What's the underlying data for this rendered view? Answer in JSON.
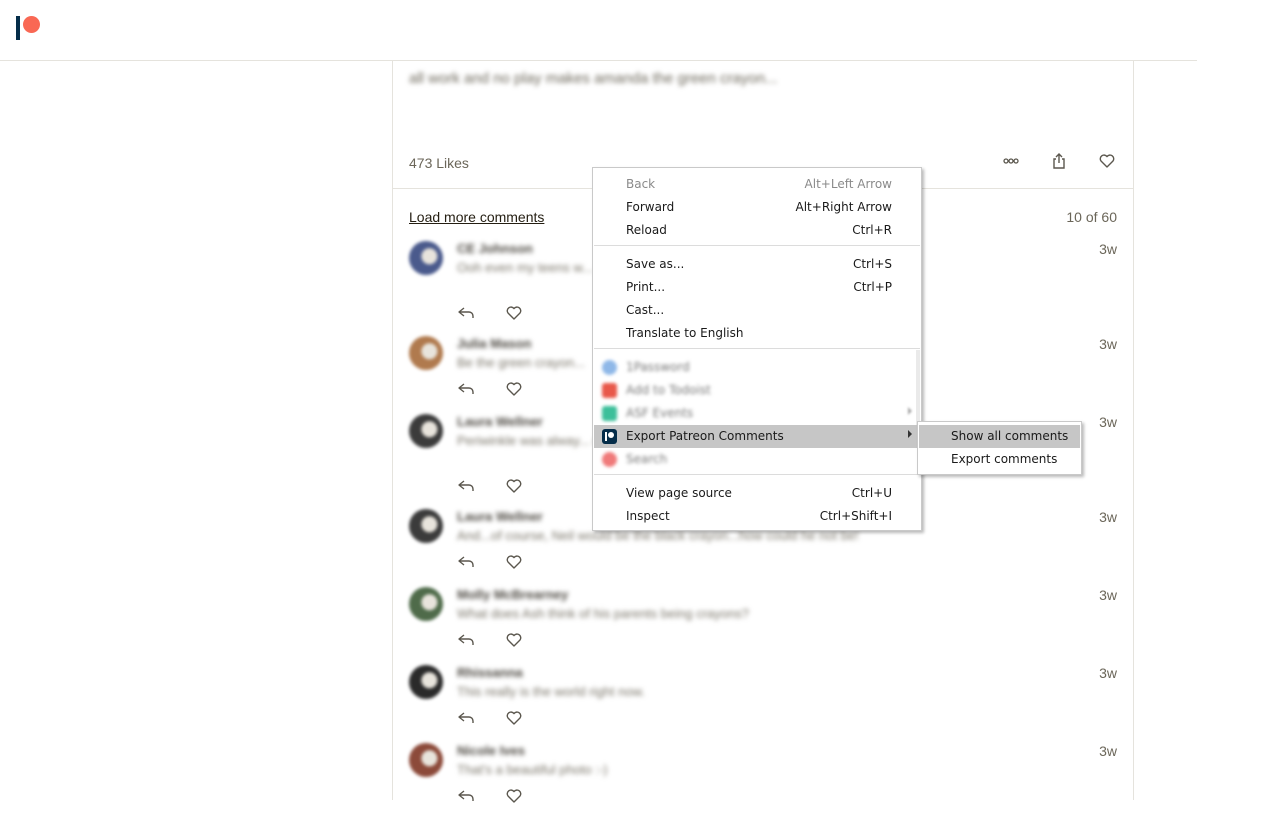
{
  "header": {
    "logo": "patreon-logo"
  },
  "post": {
    "text": "all work and no play makes amanda the green crayon...",
    "likes": "473 Likes",
    "actions": [
      "more-icon",
      "share-icon",
      "heart-icon"
    ]
  },
  "comments_bar": {
    "load_more": "Load more comments",
    "count": "10 of 60"
  },
  "comments": [
    {
      "author": "CE Johnson",
      "body": "Ooh even my teens w... you can find calm. I hope you can find groundin...",
      "time": "3w",
      "avatar_color": "#4a5a8c"
    },
    {
      "author": "Julia Mason",
      "body": "Be the green crayon...",
      "time": "3w",
      "avatar_color": "#b07a4e"
    },
    {
      "author": "Laura Wellner",
      "body": "Periwinkle was alway... my awful day job hel...",
      "time": "3w",
      "avatar_color": "#3b3b3b"
    },
    {
      "author": "Laura Wellner",
      "body": "And...of course, Neil would be the black crayon...how could he not be!",
      "time": "3w",
      "avatar_color": "#3b3b3b"
    },
    {
      "author": "Molly McBrearney",
      "body": "What does Ash think of his parents being crayons?",
      "time": "3w",
      "avatar_color": "#4f6b4a"
    },
    {
      "author": "Rhissanna",
      "body": "This really is the world right now.",
      "time": "3w",
      "avatar_color": "#2a2a2a"
    },
    {
      "author": "Nicole Ives",
      "body": "That's a beautiful photo :-)",
      "time": "3w",
      "avatar_color": "#8c4a3a"
    }
  ],
  "context_menu": {
    "back": {
      "label": "Back",
      "shortcut": "Alt+Left Arrow"
    },
    "forward": {
      "label": "Forward",
      "shortcut": "Alt+Right Arrow"
    },
    "reload": {
      "label": "Reload",
      "shortcut": "Ctrl+R"
    },
    "save_as": {
      "label": "Save as...",
      "shortcut": "Ctrl+S"
    },
    "print": {
      "label": "Print...",
      "shortcut": "Ctrl+P"
    },
    "cast": {
      "label": "Cast..."
    },
    "translate": {
      "label": "Translate to English"
    },
    "ext_1password": {
      "label": "1Password",
      "color": "#8fb8e8"
    },
    "ext_todoist": {
      "label": "Add to Todoist",
      "color": "#e8584a"
    },
    "ext_events": {
      "label": "ASF Events",
      "color": "#3cbf9a"
    },
    "export_patreon": {
      "label": "Export Patreon Comments"
    },
    "ext_search": {
      "label": "Search",
      "color": "#f07a7a"
    },
    "view_source": {
      "label": "View page source",
      "shortcut": "Ctrl+U"
    },
    "inspect": {
      "label": "Inspect",
      "shortcut": "Ctrl+Shift+I"
    }
  },
  "submenu": {
    "show_all": "Show all comments",
    "export": "Export comments"
  }
}
